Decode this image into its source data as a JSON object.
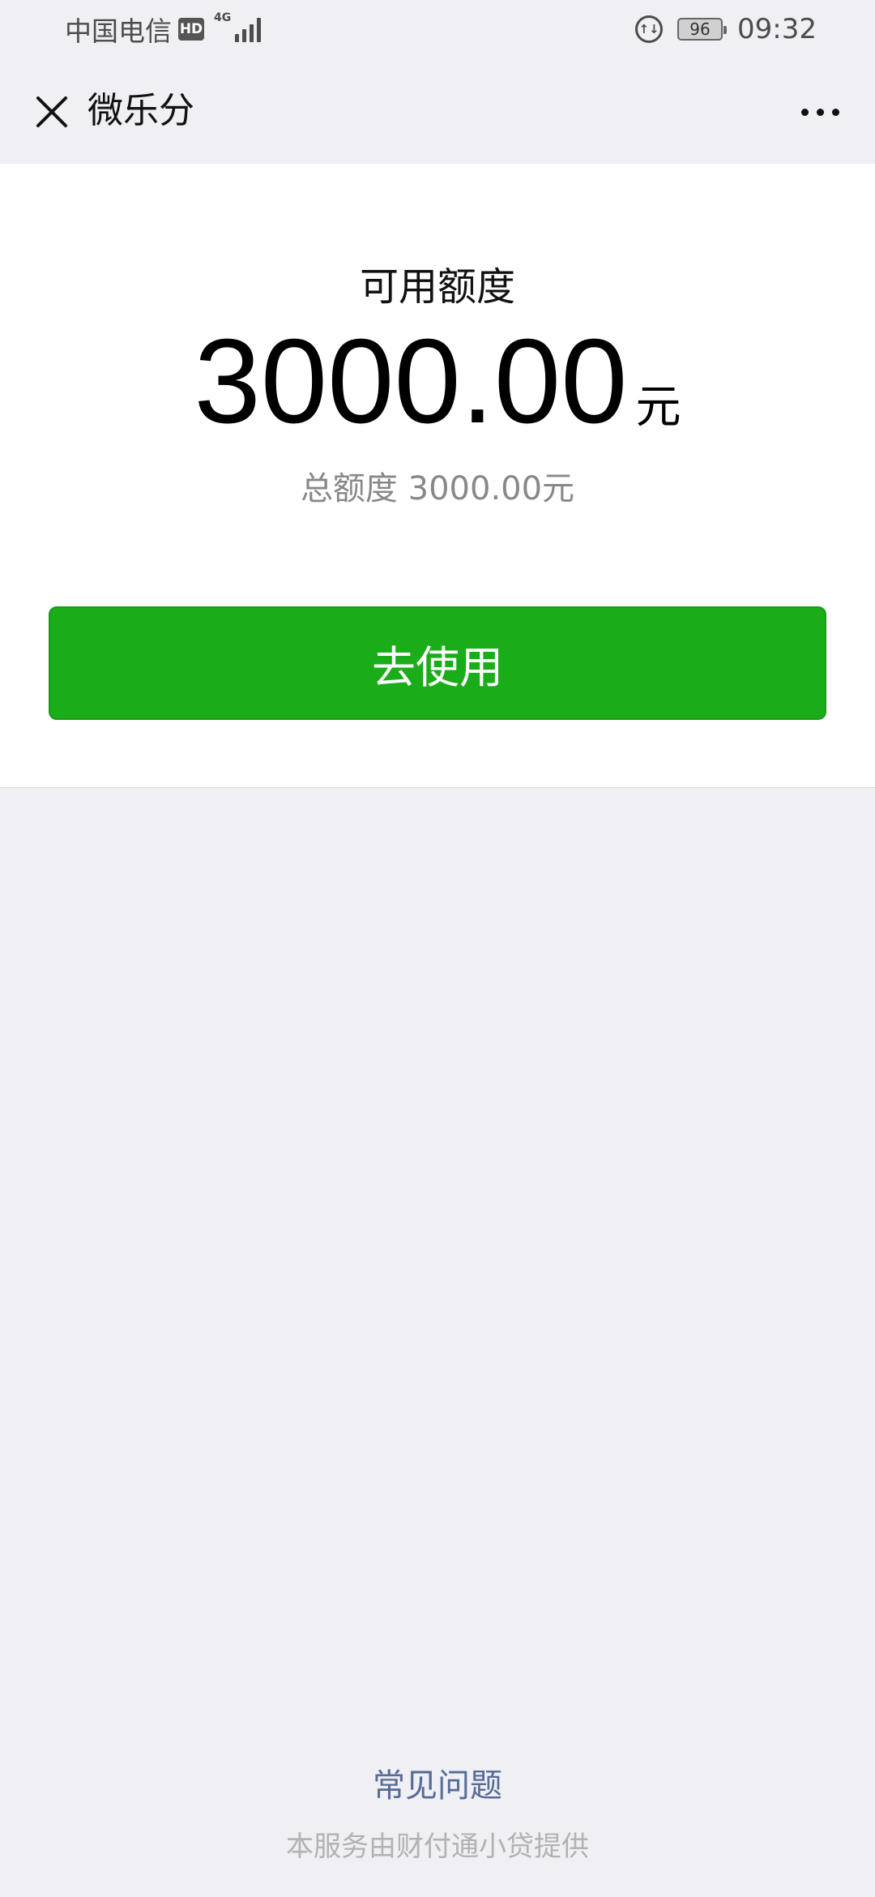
{
  "status_bar": {
    "carrier": "中国电信",
    "hd_badge": "HD",
    "network_type": "4G",
    "battery": "96",
    "time": "09:32"
  },
  "nav": {
    "title": "微乐分",
    "close_icon": "close-icon",
    "more_icon": "more-icon"
  },
  "credit": {
    "label": "可用额度",
    "amount": "3000.00",
    "unit": "元",
    "total": "总额度 3000.00元"
  },
  "actions": {
    "use_label": "去使用"
  },
  "footer": {
    "faq": "常见问题",
    "provider": "本服务由财付通小贷提供"
  },
  "colors": {
    "primary_green": "#1aad19",
    "link_blue": "#576b95",
    "page_bg": "#efeff4"
  }
}
